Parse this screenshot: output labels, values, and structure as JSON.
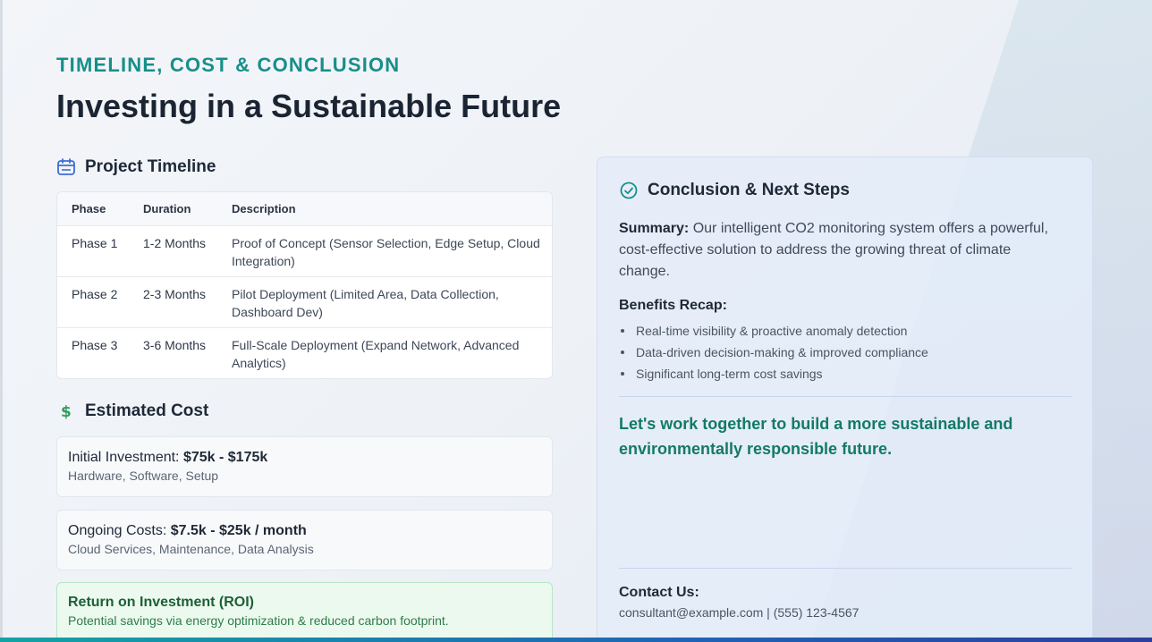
{
  "header": {
    "eyebrow": "TIMELINE, COST & CONCLUSION",
    "title": "Investing in a Sustainable Future"
  },
  "timeline": {
    "heading": "Project Timeline",
    "icon": "calendar-icon",
    "columns": [
      "Phase",
      "Duration",
      "Description"
    ],
    "rows": [
      {
        "phase": "Phase 1",
        "duration": "1-2 Months",
        "description": "Proof of Concept (Sensor Selection, Edge Setup, Cloud Integration)"
      },
      {
        "phase": "Phase 2",
        "duration": "2-3 Months",
        "description": "Pilot Deployment (Limited Area, Data Collection, Dashboard Dev)"
      },
      {
        "phase": "Phase 3",
        "duration": "3-6 Months",
        "description": "Full-Scale Deployment (Expand Network, Advanced Analytics)"
      }
    ]
  },
  "cost": {
    "heading": "Estimated Cost",
    "icon": "dollar-icon",
    "initial": {
      "label": "Initial Investment:",
      "value": "$75k - $175k",
      "sub": "Hardware, Software, Setup"
    },
    "ongoing": {
      "label": "Ongoing Costs:",
      "value": "$7.5k - $25k / month",
      "sub": "Cloud Services, Maintenance, Data Analysis"
    },
    "roi": {
      "title": "Return on Investment (ROI)",
      "sub": "Potential savings via energy optimization & reduced carbon footprint."
    }
  },
  "conclusion": {
    "heading": "Conclusion & Next Steps",
    "icon": "check-circle-icon",
    "summary_label": "Summary:",
    "summary_text": "Our intelligent CO2 monitoring system offers a powerful, cost-effective solution to address the growing threat of climate change.",
    "benefits_title": "Benefits Recap:",
    "benefits": [
      "Real-time visibility & proactive anomaly detection",
      "Data-driven decision-making & improved compliance",
      "Significant long-term cost savings"
    ],
    "cta": "Let's work together to build a more sustainable and environmentally responsible future.",
    "contact_title": "Contact Us:",
    "contact_info": "consultant@example.com | (555) 123-4567"
  },
  "colors": {
    "accent": "#178f8a",
    "cta": "#137a66",
    "roi_green": "#1d5f36",
    "icon_blue": "#3b6fd1"
  }
}
